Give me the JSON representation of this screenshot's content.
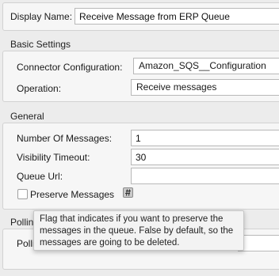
{
  "display_name": {
    "label": "Display Name:",
    "value": "Receive Message from ERP Queue"
  },
  "basic_settings": {
    "title": "Basic Settings",
    "connector_configuration": {
      "label": "Connector Configuration:",
      "value": "Amazon_SQS__Configuration"
    },
    "operation": {
      "label": "Operation:",
      "value": "Receive messages"
    }
  },
  "general": {
    "title": "General",
    "number_of_messages": {
      "label": "Number Of Messages:",
      "value": "1"
    },
    "visibility_timeout": {
      "label": "Visibility Timeout:",
      "value": "30"
    },
    "queue_url": {
      "label": "Queue Url:",
      "value": ""
    },
    "preserve_messages": {
      "label": "Preserve Messages",
      "checked": false
    }
  },
  "polling": {
    "title": "Polling",
    "field_label": "Pollin"
  },
  "tooltip": {
    "lines": [
      "Flag that indicates if you want to preserve the",
      "messages in the queue. False by default, so the",
      "messages are going to be deleted."
    ]
  }
}
